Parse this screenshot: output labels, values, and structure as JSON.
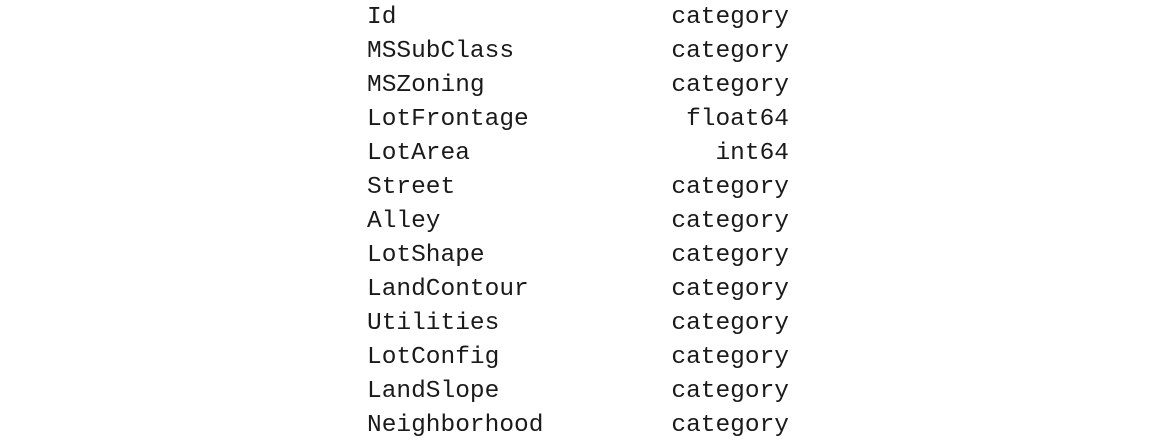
{
  "dtypes": [
    {
      "column": "Id",
      "dtype": "category"
    },
    {
      "column": "MSSubClass",
      "dtype": "category"
    },
    {
      "column": "MSZoning",
      "dtype": "category"
    },
    {
      "column": "LotFrontage",
      "dtype": "float64"
    },
    {
      "column": "LotArea",
      "dtype": "int64"
    },
    {
      "column": "Street",
      "dtype": "category"
    },
    {
      "column": "Alley",
      "dtype": "category"
    },
    {
      "column": "LotShape",
      "dtype": "category"
    },
    {
      "column": "LandContour",
      "dtype": "category"
    },
    {
      "column": "Utilities",
      "dtype": "category"
    },
    {
      "column": "LotConfig",
      "dtype": "category"
    },
    {
      "column": "LandSlope",
      "dtype": "category"
    },
    {
      "column": "Neighborhood",
      "dtype": "category"
    }
  ]
}
